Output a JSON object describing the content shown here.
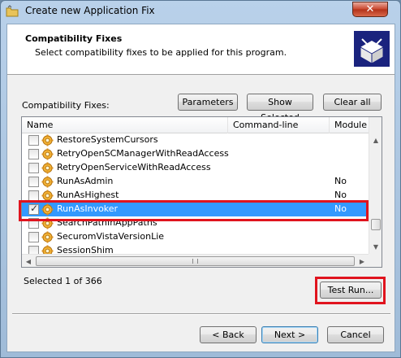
{
  "window": {
    "title": "Create new Application Fix",
    "close_glyph": "✕"
  },
  "header": {
    "title": "Compatibility Fixes",
    "subtitle": "Select compatibility fixes to be applied for this program.",
    "image_icon": "wizard-box-icon"
  },
  "fixes_label": "Compatibility Fixes:",
  "toolbar": {
    "parameters": "Parameters",
    "show_selected": "Show Selected",
    "clear_all": "Clear all"
  },
  "list": {
    "columns": [
      "Name",
      "Command-line",
      "Module"
    ],
    "rows": [
      {
        "name": "RestoreSystemCursors",
        "module": "",
        "checked": false,
        "selected": false
      },
      {
        "name": "RetryOpenSCManagerWithReadAccess",
        "module": "",
        "checked": false,
        "selected": false
      },
      {
        "name": "RetryOpenServiceWithReadAccess",
        "module": "",
        "checked": false,
        "selected": false
      },
      {
        "name": "RunAsAdmin",
        "module": "No",
        "checked": false,
        "selected": false
      },
      {
        "name": "RunAsHighest",
        "module": "No",
        "checked": false,
        "selected": false
      },
      {
        "name": "RunAsInvoker",
        "module": "No",
        "checked": true,
        "selected": true
      },
      {
        "name": "SearchPathInAppPaths",
        "module": "",
        "checked": false,
        "selected": false
      },
      {
        "name": "SecuromVistaVersionLie",
        "module": "",
        "checked": false,
        "selected": false
      },
      {
        "name": "SessionShim",
        "module": "",
        "checked": false,
        "selected": false
      }
    ]
  },
  "status": {
    "selected_count": "Selected 1 of 366"
  },
  "buttons": {
    "test_run": "Test Run...",
    "back": "< Back",
    "next": "Next >",
    "cancel": "Cancel"
  },
  "colors": {
    "highlight_box": "#e0141e",
    "selection": "#3399ff"
  }
}
